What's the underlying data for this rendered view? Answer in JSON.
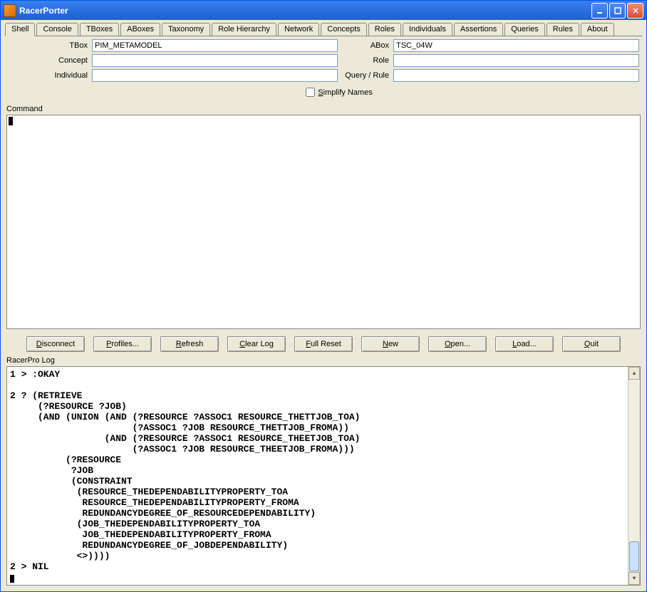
{
  "window": {
    "title": "RacerPorter"
  },
  "tabs": [
    {
      "label": "Shell",
      "active": true
    },
    {
      "label": "Console",
      "active": false
    },
    {
      "label": "TBoxes",
      "active": false
    },
    {
      "label": "ABoxes",
      "active": false
    },
    {
      "label": "Taxonomy",
      "active": false
    },
    {
      "label": "Role Hierarchy",
      "active": false
    },
    {
      "label": "Network",
      "active": false
    },
    {
      "label": "Concepts",
      "active": false
    },
    {
      "label": "Roles",
      "active": false
    },
    {
      "label": "Individuals",
      "active": false
    },
    {
      "label": "Assertions",
      "active": false
    },
    {
      "label": "Queries",
      "active": false
    },
    {
      "label": "Rules",
      "active": false
    },
    {
      "label": "About",
      "active": false
    }
  ],
  "fields": {
    "tbox": {
      "label": "TBox",
      "value": "PIM_METAMODEL"
    },
    "abox": {
      "label": "ABox",
      "value": "TSC_04W"
    },
    "concept": {
      "label": "Concept",
      "value": ""
    },
    "role": {
      "label": "Role",
      "value": ""
    },
    "individual": {
      "label": "Individual",
      "value": ""
    },
    "queryrule": {
      "label": "Query / Rule",
      "value": ""
    }
  },
  "simplify": {
    "label": "Simplify Names",
    "checked": false
  },
  "command_label": "Command",
  "command_value": "",
  "buttons": {
    "disconnect": "Disconnect",
    "profiles": "Profiles...",
    "refresh": "Refresh",
    "clearlog": "Clear Log",
    "fullreset": "Full Reset",
    "new": "New",
    "open": "Open...",
    "load": "Load...",
    "quit": "Quit"
  },
  "log_label": "RacerPro Log",
  "log_text": "1 > :OKAY\n\n2 ? (RETRIEVE\n     (?RESOURCE ?JOB)\n     (AND (UNION (AND (?RESOURCE ?ASSOC1 RESOURCE_THETTJOB_TOA)\n                      (?ASSOC1 ?JOB RESOURCE_THETTJOB_FROMA))\n                 (AND (?RESOURCE ?ASSOC1 RESOURCE_THEETJOB_TOA)\n                      (?ASSOC1 ?JOB RESOURCE_THEETJOB_FROMA)))\n          (?RESOURCE\n           ?JOB\n           (CONSTRAINT\n            (RESOURCE_THEDEPENDABILITYPROPERTY_TOA\n             RESOURCE_THEDEPENDABILITYPROPERTY_FROMA\n             REDUNDANCYDEGREE_OF_RESOURCEDEPENDABILITY)\n            (JOB_THEDEPENDABILITYPROPERTY_TOA\n             JOB_THEDEPENDABILITYPROPERTY_FROMA\n             REDUNDANCYDEGREE_OF_JOBDEPENDABILITY)\n            <>))))\n2 > NIL\n"
}
